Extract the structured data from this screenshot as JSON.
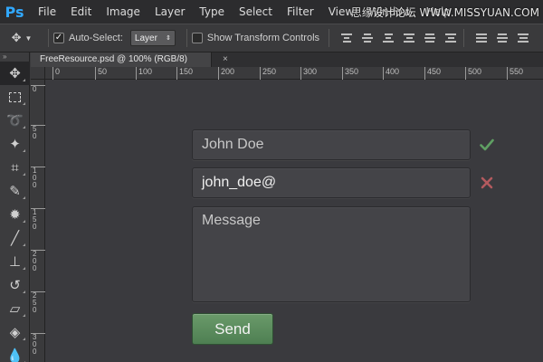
{
  "app": {
    "logo": "Ps"
  },
  "menu": [
    "File",
    "Edit",
    "Image",
    "Layer",
    "Type",
    "Select",
    "Filter",
    "View",
    "Window",
    "Help"
  ],
  "watermark": "思缘设计论坛 WWW.MISSYUAN.COM",
  "options_bar": {
    "auto_select_label": "Auto-Select:",
    "auto_select_checked": true,
    "auto_select_target": "Layer",
    "transform_controls_label": "Show Transform Controls",
    "transform_controls_checked": false
  },
  "tools": [
    "move-tool",
    "marquee-tool",
    "lasso-tool",
    "magic-wand-tool",
    "crop-tool",
    "eyedropper-tool",
    "healing-brush-tool",
    "brush-tool",
    "clone-stamp-tool",
    "history-brush-tool",
    "eraser-tool",
    "paint-bucket-tool",
    "blur-tool"
  ],
  "document": {
    "tab_title": "FreeResource.psd @ 100% (RGB/8)",
    "close_glyph": "×"
  },
  "rulers": {
    "horizontal": [
      "0",
      "50",
      "100",
      "150",
      "200",
      "250",
      "300",
      "350",
      "400",
      "450",
      "500",
      "550"
    ],
    "vertical": [
      "0",
      "50",
      "100",
      "150",
      "200",
      "250",
      "300"
    ]
  },
  "form": {
    "name_value": "John Doe",
    "name_status": "valid",
    "email_value": "john_doe@",
    "email_status": "invalid",
    "message_placeholder": "Message",
    "send_label": "Send"
  },
  "colors": {
    "valid": "#5f9f63",
    "invalid": "#b35a5e",
    "send_button": "#5a8a5c"
  }
}
